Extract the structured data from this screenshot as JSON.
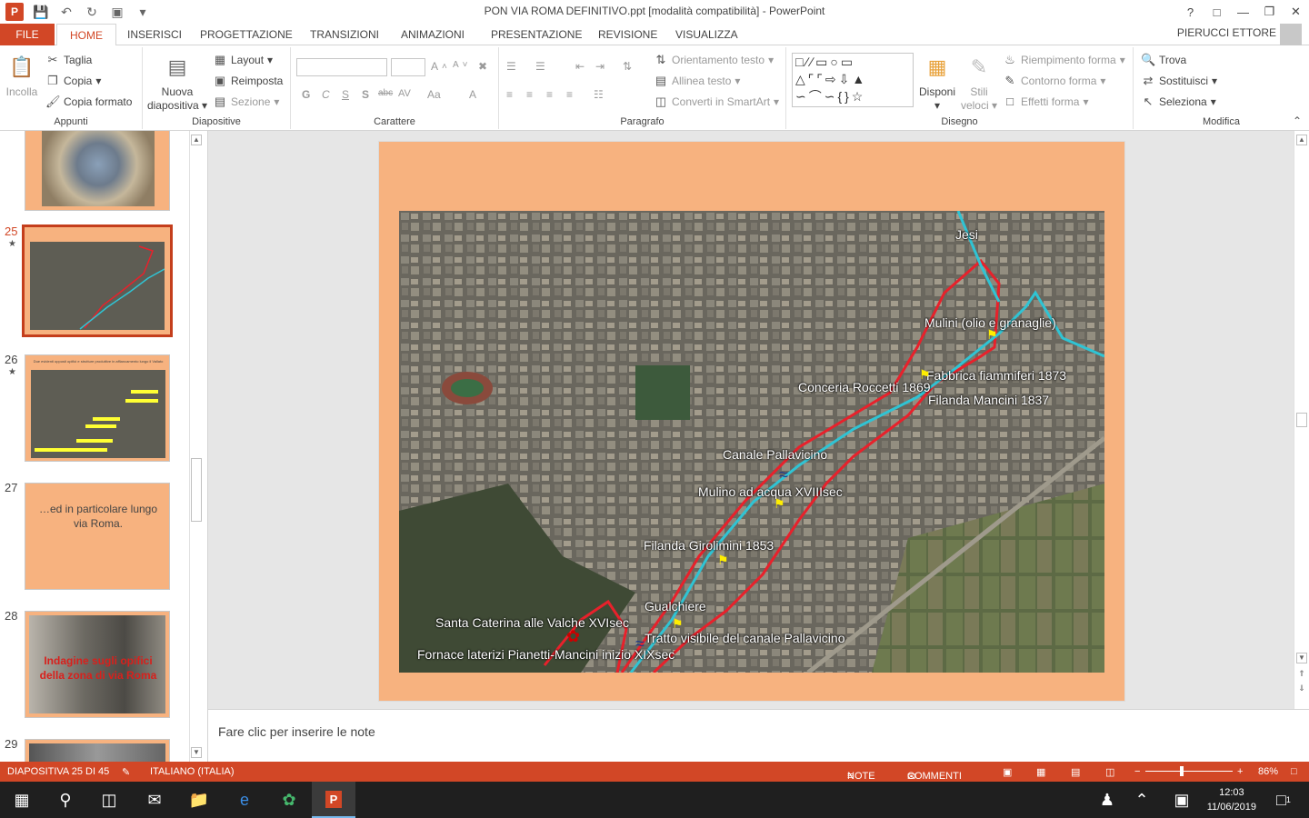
{
  "window": {
    "title": "PON VIA ROMA DEFINITIVO.ppt [modalità compatibilità] - PowerPoint",
    "help": "?",
    "controls": [
      "restore-ribbon",
      "minimize",
      "maximize",
      "close"
    ]
  },
  "tabs": [
    "FILE",
    "HOME",
    "INSERISCI",
    "PROGETTAZIONE",
    "TRANSIZIONI",
    "ANIMAZIONI",
    "PRESENTAZIONE",
    "REVISIONE",
    "VISUALIZZA"
  ],
  "active_tab": "HOME",
  "user": "PIERUCCI ETTORE",
  "ribbon": {
    "clipboard": {
      "paste": "Incolla",
      "cut": "Taglia",
      "copy": "Copia",
      "format_painter": "Copia formato",
      "label": "Appunti"
    },
    "slides": {
      "new_slide_1": "Nuova",
      "new_slide_2": "diapositiva",
      "layout": "Layout",
      "reset": "Reimposta",
      "section": "Sezione",
      "label": "Diapositive"
    },
    "font": {
      "bold": "G",
      "italic": "C",
      "underline": "S",
      "shadow": "S",
      "strike": "abc",
      "spacing": "AV",
      "case": "Aa",
      "color": "A",
      "grow": "A",
      "shrink": "A",
      "label": "Carattere"
    },
    "paragraph": {
      "text_direction": "Orientamento testo",
      "align_text": "Allinea testo",
      "smartart": "Converti in SmartArt",
      "label": "Paragrafo"
    },
    "drawing": {
      "arrange": "Disponi",
      "quick_styles_1": "Stili",
      "quick_styles_2": "veloci",
      "fill": "Riempimento forma",
      "outline": "Contorno forma",
      "effects": "Effetti forma",
      "label": "Disegno"
    },
    "editing": {
      "find": "Trova",
      "replace": "Sostituisci",
      "select": "Seleziona",
      "label": "Modifica"
    }
  },
  "thumbnails": [
    {
      "num": "25",
      "star": "★",
      "active": true
    },
    {
      "num": "26",
      "star": "★",
      "active": false,
      "caption": "Due evidenti opposti opifici e strutture produttive in affiancamento lungo il Vallato"
    },
    {
      "num": "27",
      "star": "",
      "active": false,
      "text": "…ed in particolare lungo via Roma."
    },
    {
      "num": "28",
      "star": "",
      "active": false,
      "text": "Indagine sugli opifici della zona di via Roma"
    },
    {
      "num": "29",
      "star": "",
      "active": false
    }
  ],
  "map_labels": [
    "Jesi",
    "Mulini (olio e granaglie)",
    "Fabbrica fiammiferi 1873",
    "Conceria Roccetti 1869",
    "Filanda Mancini 1837",
    "Canale Pallavicino",
    "Mulino ad acqua XVIIIsec",
    "Filanda Girolimini 1853",
    "Gualchiere",
    "Santa Caterina alle Valche XVIsec",
    "Tratto visibile del canale Pallavicino",
    "Fornace laterizi Pianetti-Mancini inizio XIXsec"
  ],
  "notes_placeholder": "Fare clic per inserire le note",
  "status": {
    "slide": "DIAPOSITIVA 25 DI 45",
    "language": "ITALIANO (ITALIA)",
    "notes": "NOTE",
    "comments": "COMMENTI",
    "zoom": "86%"
  },
  "taskbar": {
    "time": "12:03",
    "date": "11/06/2019",
    "notifications": "1"
  },
  "colors": {
    "accent": "#d24726",
    "slide_bg": "#f7b27f",
    "route_red": "#e8212b",
    "canal_cyan": "#2fc4d4"
  }
}
